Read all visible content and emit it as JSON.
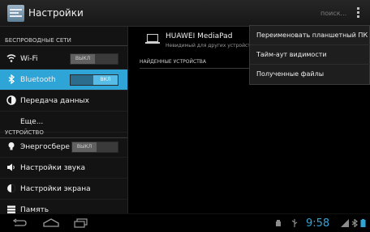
{
  "header": {
    "title": "Настройки",
    "search_label": "поиск..."
  },
  "sidebar": {
    "sections": [
      {
        "label": "БЕСПРОВОДНЫЕ СЕТИ"
      },
      {
        "label": "УСТРОЙСТВО"
      }
    ],
    "items": [
      {
        "label": "Wi-Fi",
        "icon": "wifi-icon",
        "toggle": "ВЫКЛ",
        "toggle_on": false
      },
      {
        "label": "Bluetooth",
        "icon": "bluetooth-icon",
        "toggle": "ВКЛ",
        "toggle_on": true,
        "selected": true
      },
      {
        "label": "Передача данных",
        "icon": "data-usage-icon"
      },
      {
        "label": "Еще..."
      },
      {
        "label": "Энергосбере",
        "icon": "lightbulb-icon",
        "toggle": "ВЫКЛ",
        "toggle_on": false
      },
      {
        "label": "Настройки звука",
        "icon": "speaker-icon"
      },
      {
        "label": "Настройки экрана",
        "icon": "brightness-icon"
      },
      {
        "label": "Память",
        "icon": "storage-icon"
      }
    ]
  },
  "main": {
    "device_name": "HUAWEI MediaPad",
    "device_subtitle": "Невидимый для других устройств",
    "found_header": "НАЙДЕННЫЕ УСТРОЙСТВА"
  },
  "menu": {
    "items": [
      {
        "label": "Переименовать планшетный ПК"
      },
      {
        "label": "Тайм-аут видимости"
      },
      {
        "label": "Полученные файлы"
      }
    ]
  },
  "statusbar": {
    "time": "9:58"
  },
  "colors": {
    "accent": "#2fa4d6"
  }
}
